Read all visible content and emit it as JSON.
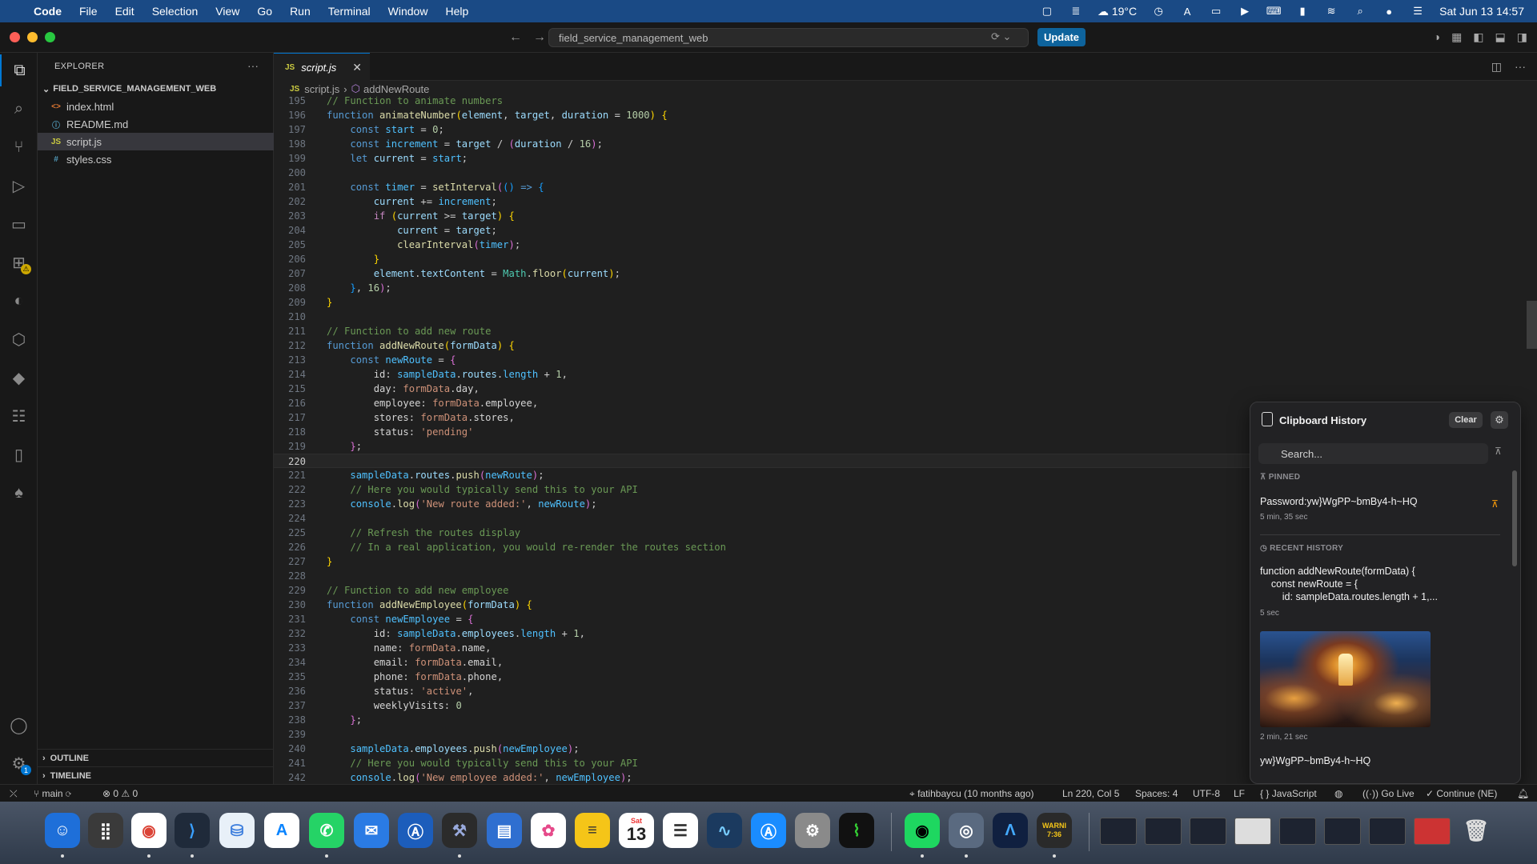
{
  "menubar": {
    "app": "Code",
    "items": [
      "File",
      "Edit",
      "Selection",
      "View",
      "Go",
      "Run",
      "Terminal",
      "Window",
      "Help"
    ],
    "weather": "19°C",
    "datetime": "Sat Jun 13  14:57"
  },
  "titlebar": {
    "command_center": "field_service_management_web",
    "update_label": "Update"
  },
  "sidebar": {
    "title": "EXPLORER",
    "more": "···",
    "folder": "FIELD_SERVICE_MANAGEMENT_WEB",
    "files": [
      {
        "name": "index.html",
        "icon": "<>",
        "icon_color": "#e37933"
      },
      {
        "name": "README.md",
        "icon": "ⓘ",
        "icon_color": "#519aba"
      },
      {
        "name": "script.js",
        "icon": "JS",
        "icon_color": "#cbcb41"
      },
      {
        "name": "styles.css",
        "icon": "#",
        "icon_color": "#519aba"
      }
    ],
    "outline": "OUTLINE",
    "timeline": "TIMELINE"
  },
  "activitybar": {
    "extensions_badge": "⚠",
    "accounts_badge": "1"
  },
  "editor": {
    "tab": {
      "icon": "JS",
      "label": "script.js"
    },
    "breadcrumb": {
      "icon": "JS",
      "file": "script.js",
      "symbol": "addNewRoute"
    },
    "current_line": 220
  },
  "clipboard": {
    "title": "Clipboard History",
    "clear_label": "Clear",
    "search_placeholder": "Search...",
    "pinned_label": "PINNED",
    "pinned_item": {
      "text": "Password:yw}WgPP~bmBy4-h~HQ",
      "time": "5 min, 35 sec"
    },
    "recent_label": "RECENT HISTORY",
    "recent_items": [
      {
        "lines": [
          "function addNewRoute(formData) {",
          "    const newRoute = {",
          "        id: sampleData.routes.length + 1,..."
        ],
        "time": "5 sec"
      },
      {
        "image": "night-city-photo",
        "time": "2 min, 21 sec"
      },
      {
        "text": "yw}WgPP~bmBy4-h~HQ"
      }
    ]
  },
  "statusbar": {
    "branch": "main",
    "errors": "0",
    "warnings": "0",
    "blame": "fatihbaycu (10 months ago)",
    "position": "Ln 220, Col 5",
    "spaces": "Spaces: 4",
    "encoding": "UTF-8",
    "eol": "LF",
    "language": "JavaScript",
    "golive": "Go Live",
    "continue": "Continue (NE)"
  },
  "dock": {
    "calendar_month": "Sat",
    "calendar_day": "13",
    "warning_widget": [
      "WARNI",
      "7:36"
    ]
  },
  "colors": {
    "accent": "#0078d4",
    "menubar": "#1a4a85",
    "editor_bg": "#1f1f1f"
  }
}
